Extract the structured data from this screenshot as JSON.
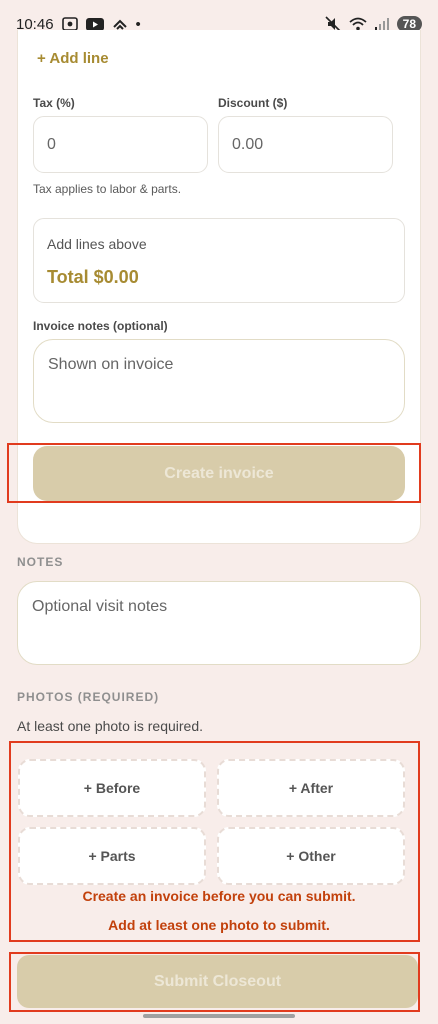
{
  "status": {
    "time": "10:46",
    "dot": "•",
    "battery": "78"
  },
  "invoice": {
    "add_line": "+ Add line",
    "tax_label": "Tax (%)",
    "tax_value": "0",
    "discount_label": "Discount ($)",
    "discount_value": "0.00",
    "tax_hint": "Tax applies to labor & parts.",
    "total_hint": "Add lines above",
    "total": "Total $0.00",
    "notes_label": "Invoice notes (optional)",
    "notes_placeholder": "Shown on invoice",
    "create_button": "Create invoice"
  },
  "notes": {
    "title": "NOTES",
    "placeholder": "Optional visit notes"
  },
  "photos": {
    "title": "PHOTOS (REQUIRED)",
    "hint": "At least one photo is required.",
    "tiles": [
      "+ Before",
      "+ After",
      "+ Parts",
      "+ Other"
    ]
  },
  "errors": {
    "invoice": "Create an invoice before you can submit.",
    "photo": "Add at least one photo to submit."
  },
  "submit_button": "Submit Closeout",
  "colors": {
    "background": "#f8edea",
    "accent": "#a78b32",
    "disabled_button": "#d8ccaa",
    "error": "#c2410c",
    "highlight": "#e13b1e"
  }
}
